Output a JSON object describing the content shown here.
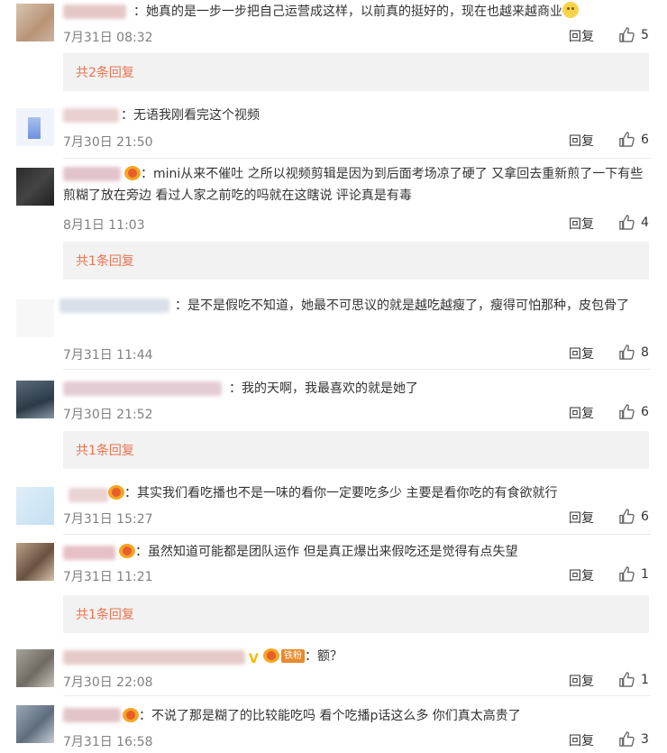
{
  "labels": {
    "reply": "回复"
  },
  "comments": [
    {
      "text": "：她真的是一步一步把自己运营成这样，以前真的挺好的，现在也越来越商业",
      "time": "7月31日 08:32",
      "likes": "5",
      "sub_replies": "共2条回复"
    },
    {
      "text": "：无语我刚看完这个视频",
      "time": "7月30日 21:50",
      "likes": "6"
    },
    {
      "text": "：mini从来不催吐 之所以视频剪辑是因为到后面考场凉了硬了 又拿回去重新煎了一下有些煎糊了放在旁边 看过人家之前吃的吗就在这瞎说 评论真是有毒",
      "time": "8月1日 11:03",
      "likes": "4",
      "sub_replies": "共1条回复"
    },
    {
      "text": "：是不是假吃不知道，她最不可思议的就是越吃越瘦了，瘦得可怕那种，皮包骨了",
      "time": "7月31日 11:44",
      "likes": "8"
    },
    {
      "text": "：我的天啊，我最喜欢的就是她了",
      "time": "7月30日 21:52",
      "likes": "6",
      "sub_replies": "共1条回复"
    },
    {
      "text": "：其实我们看吃播也不是一味的看你一定要吃多少 主要是看你吃的有食欲就行",
      "time": "7月31日 15:27",
      "likes": "6"
    },
    {
      "text": "：虽然知道可能都是团队运作 但是真正爆出来假吃还是觉得有点失望",
      "time": "7月31日 11:21",
      "likes": "1",
      "sub_replies": "共1条回复"
    },
    {
      "text": "：额？",
      "time": "7月30日 22:08",
      "likes": "1",
      "fan_badge": "铁粉"
    },
    {
      "text": "：不说了那是糊了的比较能吃吗 看个吃播p话这么多 你们真太高贵了",
      "time": "7月31日 16:58",
      "likes": "3"
    }
  ],
  "colors": {
    "sub_reply_link": "#eb7350",
    "timestamp": "#808080",
    "sub_reply_bg": "#f2f2f2"
  }
}
